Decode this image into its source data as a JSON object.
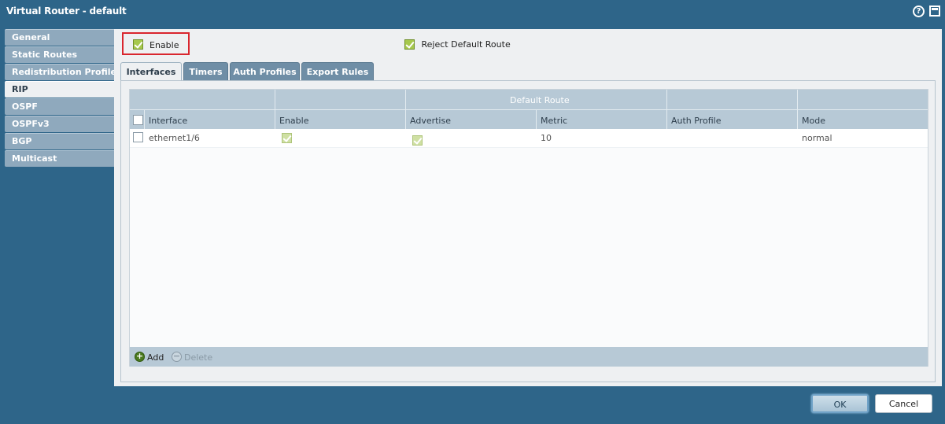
{
  "window": {
    "title": "Virtual Router - default",
    "help_icon": "question-circle-icon",
    "maximize_icon": "maximize-icon"
  },
  "sidebar": {
    "items": [
      {
        "label": "General",
        "active": false
      },
      {
        "label": "Static Routes",
        "active": false
      },
      {
        "label": "Redistribution Profile",
        "active": false
      },
      {
        "label": "RIP",
        "active": true
      },
      {
        "label": "OSPF",
        "active": false
      },
      {
        "label": "OSPFv3",
        "active": false
      },
      {
        "label": "BGP",
        "active": false
      },
      {
        "label": "Multicast",
        "active": false
      }
    ]
  },
  "rip": {
    "enable_label": "Enable",
    "enable_checked": true,
    "reject_default_route_label": "Reject Default Route",
    "reject_default_route_checked": true
  },
  "tabs": [
    {
      "label": "Interfaces",
      "active": true
    },
    {
      "label": "Timers",
      "active": false
    },
    {
      "label": "Auth Profiles",
      "active": false
    },
    {
      "label": "Export Rules",
      "active": false
    }
  ],
  "grid": {
    "group_header": "Default Route",
    "columns": [
      "Interface",
      "Enable",
      "Advertise",
      "Metric",
      "Auth Profile",
      "Mode"
    ],
    "rows": [
      {
        "interface": "ethernet1/6",
        "enable": true,
        "advertise": true,
        "metric": "10",
        "auth_profile": "",
        "mode": "normal"
      }
    ],
    "add_label": "Add",
    "delete_label": "Delete"
  },
  "buttons": {
    "ok": "OK",
    "cancel": "Cancel"
  },
  "colors": {
    "accent": "#2e6589",
    "highlight_box": "#d9262e",
    "checkbox_checked": "#a6c84c"
  }
}
